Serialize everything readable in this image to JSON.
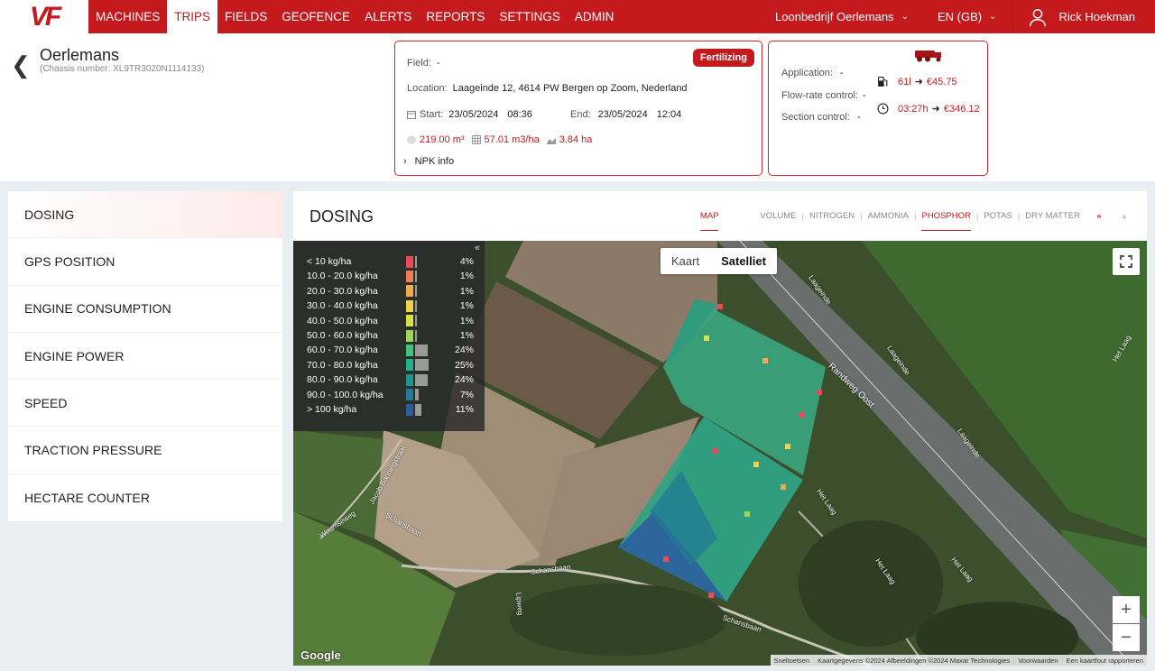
{
  "nav": {
    "logo": "VF",
    "items": [
      "MACHINES",
      "TRIPS",
      "FIELDS",
      "GEOFENCE",
      "ALERTS",
      "REPORTS",
      "SETTINGS",
      "ADMIN"
    ],
    "active": "TRIPS",
    "company": "Loonbedrijf Oerlemans",
    "language": "EN (GB)",
    "user": "Rick Hoekman"
  },
  "machine": {
    "name": "Oerlemans",
    "chassis": "(Chassis number: XL9TR3020N1114133)"
  },
  "trip": {
    "badge": "Fertilizing",
    "field_label": "Field:",
    "field_value": "-",
    "location_label": "Location:",
    "location_value": "Laageinde 12, 4614 PW Bergen op Zoom, Nederland",
    "start_label": "Start:",
    "start_date": "23/05/2024",
    "start_time": "08:36",
    "end_label": "End:",
    "end_date": "23/05/2024",
    "end_time": "12:04",
    "volume": "219.00 m³",
    "rate": "57.01 m3/ha",
    "area": "3.84 ha",
    "npk": "NPK info"
  },
  "costs": {
    "application_label": "Application:",
    "application_value": "-",
    "flow_label": "Flow-rate control:",
    "flow_value": "-",
    "section_label": "Section control:",
    "section_value": "-",
    "fuel": "61l",
    "fuel_cost": "€45.75",
    "time": "03:27h",
    "time_cost": "€346.12"
  },
  "sidebar": {
    "items": [
      "DOSING",
      "GPS POSITION",
      "ENGINE CONSUMPTION",
      "ENGINE POWER",
      "SPEED",
      "TRACTION PRESSURE",
      "HECTARE COUNTER"
    ]
  },
  "main": {
    "title": "DOSING",
    "tab_map": "MAP",
    "tabs": [
      "VOLUME",
      "NITROGEN",
      "AMMONIA",
      "PHOSPHOR",
      "POTAS",
      "DRY MATTER"
    ],
    "active_tab": "PHOSPHOR"
  },
  "legend": {
    "collapse": "«",
    "rows": [
      {
        "label": "< 10 kg/ha",
        "pct": "4%",
        "value": 4,
        "color": "#e94a5a"
      },
      {
        "label": "10.0 - 20.0 kg/ha",
        "pct": "1%",
        "value": 1,
        "color": "#ef7d52"
      },
      {
        "label": "20.0 - 30.0 kg/ha",
        "pct": "1%",
        "value": 1,
        "color": "#f0a94c"
      },
      {
        "label": "30.0 - 40.0 kg/ha",
        "pct": "1%",
        "value": 1,
        "color": "#f2d04c"
      },
      {
        "label": "40.0 - 50.0 kg/ha",
        "pct": "1%",
        "value": 1,
        "color": "#d6e24a"
      },
      {
        "label": "50.0 - 60.0 kg/ha",
        "pct": "1%",
        "value": 1,
        "color": "#9bd65a"
      },
      {
        "label": "60.0 - 70.0 kg/ha",
        "pct": "24%",
        "value": 24,
        "color": "#3fc47f"
      },
      {
        "label": "70.0 - 80.0 kg/ha",
        "pct": "25%",
        "value": 25,
        "color": "#25b08c"
      },
      {
        "label": "80.0 - 90.0 kg/ha",
        "pct": "24%",
        "value": 24,
        "color": "#1e9690"
      },
      {
        "label": "90.0 - 100.0 kg/ha",
        "pct": "7%",
        "value": 7,
        "color": "#237b95"
      },
      {
        "label": "> 100 kg/ha",
        "pct": "11%",
        "value": 11,
        "color": "#2a5c9e"
      }
    ]
  },
  "map": {
    "maptype_map": "Kaart",
    "maptype_sat": "Satelliet",
    "zoom_in": "+",
    "zoom_out": "−",
    "google": "Google",
    "attribution": [
      "Sneltoetsen",
      "Kaartgegevens ©2024 Afbeeldingen ©2024 Maxar Technologies",
      "Voorwaarden",
      "Een kaartfout rapporteren"
    ],
    "roads": [
      "Randweg Oost",
      "Laageinde",
      "Laageinde",
      "Laageinde",
      "Het Laag",
      "Het Laag",
      "Het Laag",
      "Het Laag",
      "Schansbaan",
      "Schansbaan",
      "Schansbaan",
      "Lipweg",
      "Jacob Banningstraat",
      "Woumseweg"
    ]
  }
}
